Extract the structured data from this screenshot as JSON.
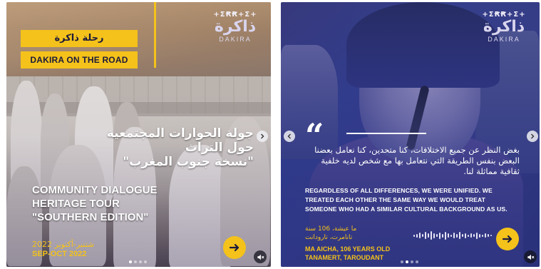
{
  "brand": {
    "tifinagh": "+ΣꞦꞦ+Σ+",
    "arabic": "ذاكرة",
    "latin": "DAKIRA"
  },
  "colors": {
    "accent_yellow": "#f4c21a",
    "overlay_blue": "#35408c",
    "text_dark": "#1d1a3a"
  },
  "post1": {
    "tag_ar": "رحلة ذاكرة",
    "tag_en": "DAKIRA ON THE ROAD",
    "title_ar": [
      "جولة الحوارات المجتمعية",
      "حول التراث",
      "\"نسخة جنوب المغرب\""
    ],
    "title_en": [
      "COMMUNITY DIALOGUE",
      "HERITAGE TOUR",
      "\"SOUTHERN EDITION\""
    ],
    "date_ar": "شتنبر-أكتوبر 2022",
    "date_en": "SEP-OCT 2022",
    "icons": [
      "chevron-right-icon",
      "arrow-right-icon",
      "mute-icon"
    ]
  },
  "post2": {
    "quote_ar": "بغض النظر عن جميع الاختلافات، كنا متحدين، كنا نعامل بعضنا البعض بنفس الطريقة التي نتعامل بها مع شخص لديه خلفية ثقافية مماثلة لنا.",
    "quote_en": "REGARDLESS OF ALL DIFFERENCES, WE WERE UNIFIED. WE TREATED EACH OTHER THE SAME WAY WE WOULD TREAT SOMEONE WHO HAD A SIMILAR CULTURAL BACKGROUND AS US.",
    "attribution_ar": [
      "ما عيشة، 106 سنة",
      "تانامرت، تارودانت"
    ],
    "attribution_en": [
      "MA AICHA, 106 YEARS OLD",
      "TANAMERT, TAROUDANT"
    ],
    "icons": [
      "quote-icon",
      "chevron-left-icon",
      "chevron-right-icon",
      "arrow-right-icon",
      "mute-icon",
      "audio-waveform-icon"
    ]
  }
}
